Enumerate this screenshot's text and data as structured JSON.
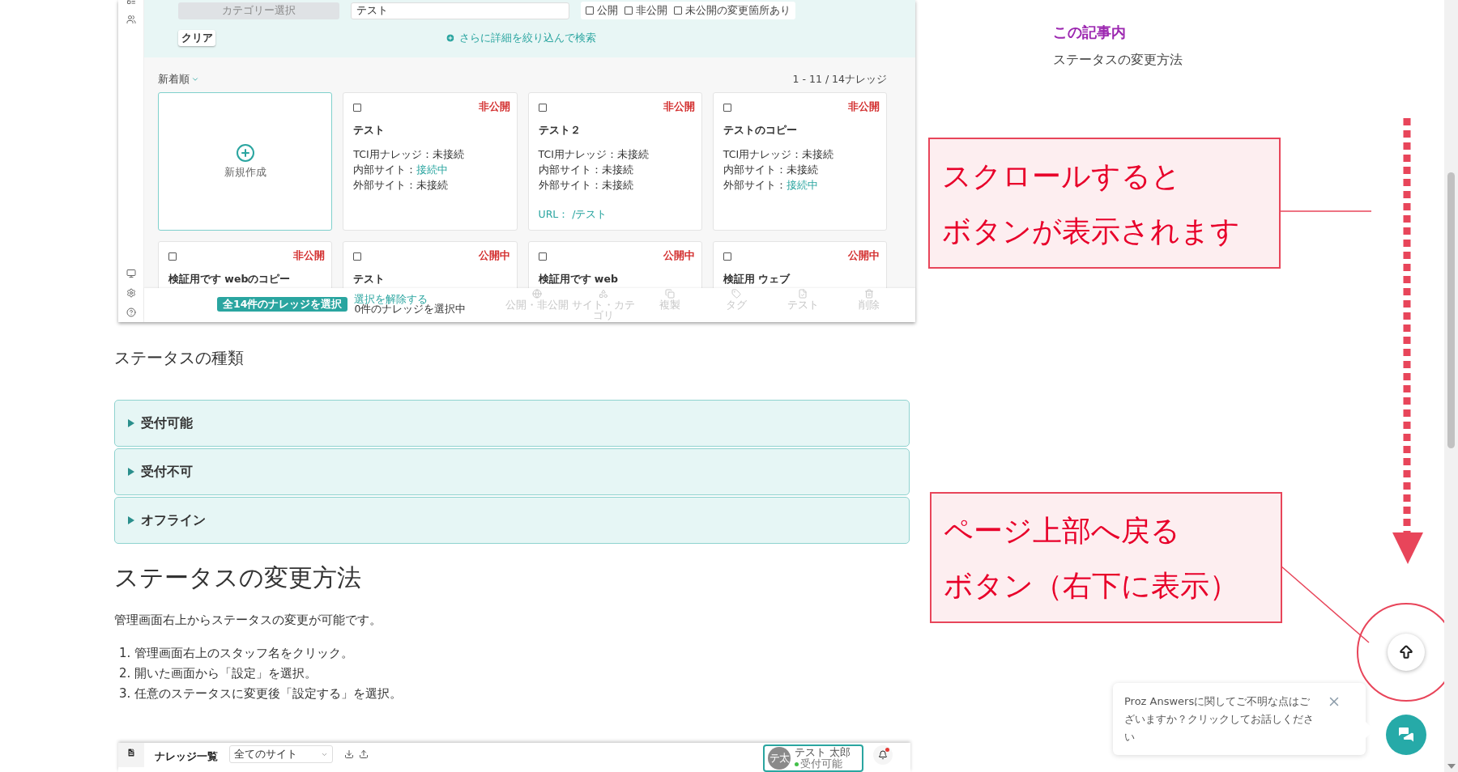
{
  "embedded_screenshot_top": {
    "filter": {
      "category_select": {
        "placeholder": "カテゴリー選択"
      },
      "keyword_field": {
        "value": "テスト"
      },
      "status_filters": [
        {
          "label": "公開",
          "checked": false
        },
        {
          "label": "非公開",
          "checked": false
        },
        {
          "label": "未公開の変更箇所あり",
          "checked": false
        }
      ],
      "clear_button": "クリア",
      "advanced_search": "さらに詳細を絞り込んで検索"
    },
    "sort": "新着順",
    "count": "1 - 11 / 14ナレッジ",
    "new_card": {
      "label": "新規作成"
    },
    "cards": [
      {
        "checked": false,
        "status": "非公開",
        "title": "テスト",
        "fields": [
          {
            "label": "TCI用ナレッジ：",
            "value": "未接続",
            "connected": false
          },
          {
            "label": "内部サイト：",
            "value": "接続中",
            "connected": true
          },
          {
            "label": "外部サイト：",
            "value": "未接続",
            "connected": false
          }
        ]
      },
      {
        "checked": false,
        "status": "非公開",
        "title": "テスト２",
        "fields": [
          {
            "label": "TCI用ナレッジ：",
            "value": "未接続",
            "connected": false
          },
          {
            "label": "内部サイト：",
            "value": "未接続",
            "connected": false
          },
          {
            "label": "外部サイト：",
            "value": "未接続",
            "connected": false
          }
        ],
        "url": "URL： /テスト"
      },
      {
        "checked": false,
        "status": "非公開",
        "title": "テストのコピー",
        "fields": [
          {
            "label": "TCI用ナレッジ：",
            "value": "未接続",
            "connected": false
          },
          {
            "label": "内部サイト：",
            "value": "未接続",
            "connected": false
          },
          {
            "label": "外部サイト：",
            "value": "接続中",
            "connected": true
          }
        ]
      },
      {
        "checked": false,
        "status": "非公開",
        "title": "検証用です webのコピー"
      },
      {
        "checked": false,
        "status": "公開中",
        "title": "テスト"
      },
      {
        "checked": false,
        "status": "公開中",
        "title": "検証用です web"
      },
      {
        "checked": false,
        "status": "公開中",
        "title": "検証用 ウェブ"
      }
    ],
    "bottom_bar": {
      "select_all_button": "全14件のナレッジを選択",
      "deselect_link": "選択を解除する",
      "selection_count": "0件のナレッジを選択中",
      "actions": [
        {
          "kind": "publish",
          "label": "公開・非公開",
          "disabled": true
        },
        {
          "kind": "site",
          "label": "サイト・カテゴリ",
          "disabled": true
        },
        {
          "kind": "duplicate",
          "label": "複製",
          "disabled": true
        },
        {
          "kind": "tag",
          "label": "タグ",
          "disabled": true
        },
        {
          "kind": "test",
          "label": "テスト",
          "disabled": true
        },
        {
          "kind": "delete",
          "label": "削除",
          "disabled": true
        }
      ]
    }
  },
  "article": {
    "section_heading": "ステータスの種類",
    "accordions": [
      {
        "label": "受付可能",
        "expanded": false
      },
      {
        "label": "受付不可",
        "expanded": false
      },
      {
        "label": "オフライン",
        "expanded": false
      }
    ],
    "heading": "ステータスの変更方法",
    "paragraph": "管理画面右上からステータスの変更が可能です。",
    "steps": [
      {
        "number": "1.",
        "text": "管理画面右上のスタッフ名をクリック。"
      },
      {
        "number": "2.",
        "text": "開いた画面から「設定」を選択。"
      },
      {
        "number": "3.",
        "text": "任意のステータスに変更後「設定する」を選択。"
      }
    ]
  },
  "embedded_screenshot_bottom": {
    "page_title": "ナレッジ一覧",
    "site_select": "全てのサイト",
    "user": {
      "avatar": "テ太",
      "name": "テスト 太郎",
      "status": "受付可能"
    },
    "has_notification": true
  },
  "toc": {
    "title": "この記事内",
    "items": [
      {
        "label": "ステータスの変更方法"
      }
    ]
  },
  "callouts": [
    {
      "lines": [
        "スクロールすると",
        "ボタンが表示されます"
      ]
    },
    {
      "lines": [
        "ページ上部へ戻る",
        "ボタン（右下に表示）"
      ]
    }
  ],
  "chat": {
    "message": "Proz Answersに関してご不明な点はございますか？クリックしてお話しください"
  }
}
